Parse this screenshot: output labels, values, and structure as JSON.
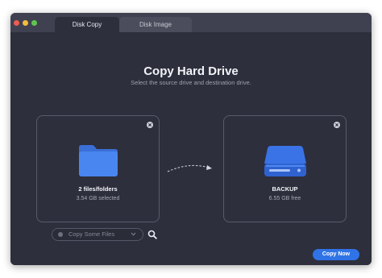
{
  "tabs": [
    {
      "label": "Disk Copy",
      "active": true
    },
    {
      "label": "Disk Image",
      "active": false
    }
  ],
  "main": {
    "title": "Copy Hard Drive",
    "subtitle": "Select the source drive and destination drive."
  },
  "source": {
    "icon": "folder-icon",
    "name": "2 files/folders",
    "detail": "3.54 GB selected"
  },
  "destination": {
    "icon": "hard-drive-icon",
    "name": "BACKUP",
    "detail": "6.55 GB free"
  },
  "copy_mode": {
    "selected": "Copy Some Files"
  },
  "actions": {
    "copy_now": "Copy Now"
  },
  "colors": {
    "accent": "#2f73e6",
    "window_bg": "#2d2f3c",
    "titlebar_bg": "#3f4150"
  }
}
